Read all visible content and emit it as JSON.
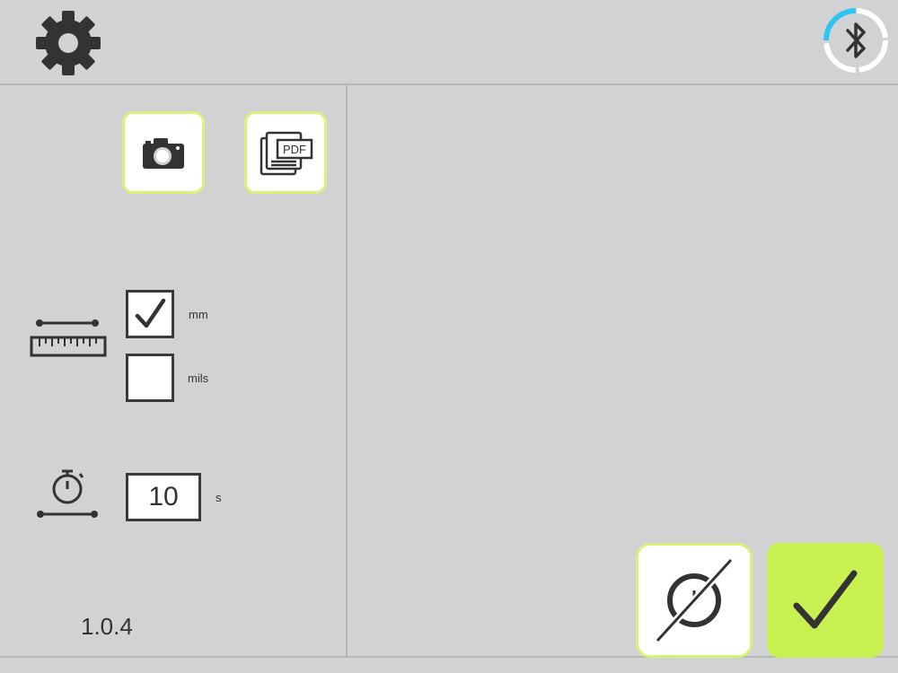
{
  "header": {
    "settings_icon": "gear-icon",
    "bluetooth_icon": "bluetooth-icon"
  },
  "export": {
    "camera_icon": "camera-icon",
    "pdf_icon": "pdf-icon",
    "pdf_label": "PDF"
  },
  "units": {
    "options": [
      {
        "label": "mm",
        "checked": true
      },
      {
        "label": "mils",
        "checked": false
      }
    ]
  },
  "timer": {
    "value": "10",
    "unit": "s"
  },
  "version": "1.0.4",
  "actions": {
    "cancel_icon": "cancel-measure-icon",
    "confirm_icon": "check-icon"
  },
  "colors": {
    "accent": "#c8f051",
    "tile_border": "#d9f27a",
    "bluetooth_ring": "#2ec4f0",
    "background": "#d1d2d3"
  }
}
